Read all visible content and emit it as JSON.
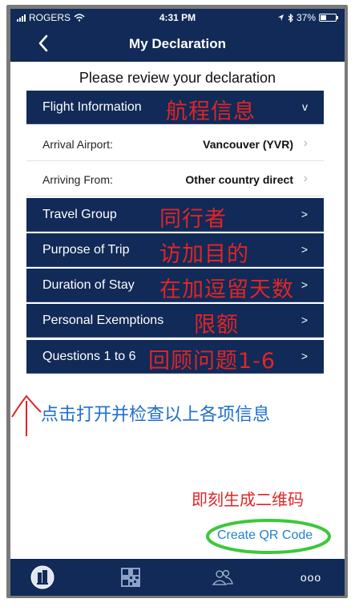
{
  "status_bar": {
    "carrier": "ROGERS",
    "time": "4:31 PM",
    "battery": "37%"
  },
  "nav": {
    "back": "<",
    "title": "My Declaration"
  },
  "subtitle": "Please review your declaration",
  "flight_info": {
    "label": "Flight Information",
    "annotation": "航程信息",
    "chevron": "v"
  },
  "details": [
    {
      "label": "Arrival Airport:",
      "value": "Vancouver (YVR)"
    },
    {
      "label": "Arriving From:",
      "value": "Other country direct"
    }
  ],
  "sections": [
    {
      "label": "Travel Group",
      "annotation": "同行者",
      "chevron": ">"
    },
    {
      "label": "Purpose of Trip",
      "annotation": "访加目的",
      "chevron": ">"
    },
    {
      "label": "Duration of Stay",
      "annotation": "在加逗留天数",
      "chevron": ">"
    },
    {
      "label": "Personal Exemptions",
      "annotation": "限额",
      "chevron": ">"
    },
    {
      "label": "Questions 1 to 6",
      "annotation": "回顾问题1-6",
      "chevron": ">"
    }
  ],
  "annotations": {
    "hint": "点击打开并检查以上各项信息",
    "generate": "即刻生成二维码"
  },
  "qr_link": "Create QR Code",
  "tabbar": {
    "more": "ooo"
  },
  "colors": {
    "navy": "#112a57",
    "annotation_red": "#e02525",
    "hint_blue": "#1e6fd0",
    "link_blue": "#1f82cc",
    "highlight_green": "#3cc83c"
  }
}
